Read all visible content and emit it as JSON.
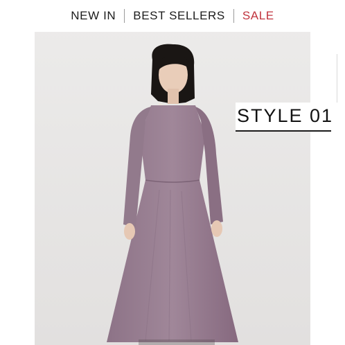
{
  "nav": {
    "items": [
      {
        "label": "NEW IN"
      },
      {
        "label": "BEST SELLERS"
      },
      {
        "label": "SALE"
      }
    ],
    "sale_color": "#c0333d"
  },
  "hero": {
    "badge_label": "STYLE 01",
    "background_color": "#e9e8e7",
    "dress_color": "#9a8194"
  }
}
